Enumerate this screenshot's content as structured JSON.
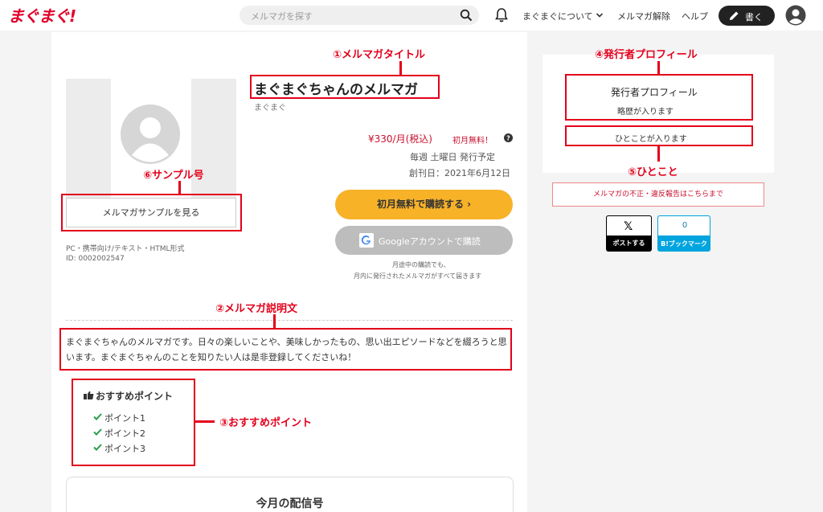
{
  "header": {
    "logo": "まぐまぐ!",
    "search_placeholder": "メルマガを探す",
    "nav_about": "まぐまぐについて",
    "nav_unsubscribe": "メルマガ解除",
    "nav_help": "ヘルプ",
    "write_label": "書く"
  },
  "magazine": {
    "title": "まぐまぐちゃんのメルマガ",
    "author": "まぐまぐ",
    "price": "¥330/月(税込)",
    "first_month_free": "初月無料！",
    "schedule": "毎週 土曜日 発行予定",
    "founded": "創刊日：2021年6月12日",
    "subscribe_button": "初月無料で購読する ›",
    "google_button": "Googleアカウントで購読",
    "note_line1": "月途中の購読でも、",
    "note_line2": "月内に発行されたメルマガがすべて届きます",
    "sample_button": "メルマガサンプルを見る",
    "format": "PC・携帯向け/テキスト・HTML形式",
    "id": "ID: 0002002547",
    "description": "まぐまぐちゃんのメルマガです。日々の楽しいことや、美味しかったもの、思い出エピソードなどを綴ろうと思います。まぐまぐちゃんのことを知りたい人は是非登録してくださいね！",
    "points_title": "おすすめポイント",
    "points": [
      "ポイント1",
      "ポイント2",
      "ポイント3"
    ],
    "monthly_title": "今月の配信号"
  },
  "publisher": {
    "profile_title": "発行者プロフィール",
    "bio": "略歴が入ります",
    "oneliner": "ひとことが入ります",
    "report": "メルマガの不正・違反報告はこちらまで",
    "post_button": "ポストする",
    "hatena_count": "0",
    "hatena_label": "B!ブックマーク"
  },
  "annotations": {
    "a1": "①メルマガタイトル",
    "a2": "②メルマガ説明文",
    "a3": "③おすすめポイント",
    "a4": "④発行者プロフィール",
    "a5": "⑤ひとこと",
    "a6": "⑥サンプル号"
  },
  "colors": {
    "brand": "#e0002a",
    "subscribe": "#f7b228",
    "annotation": "#e3001b",
    "price": "#c8102e"
  }
}
